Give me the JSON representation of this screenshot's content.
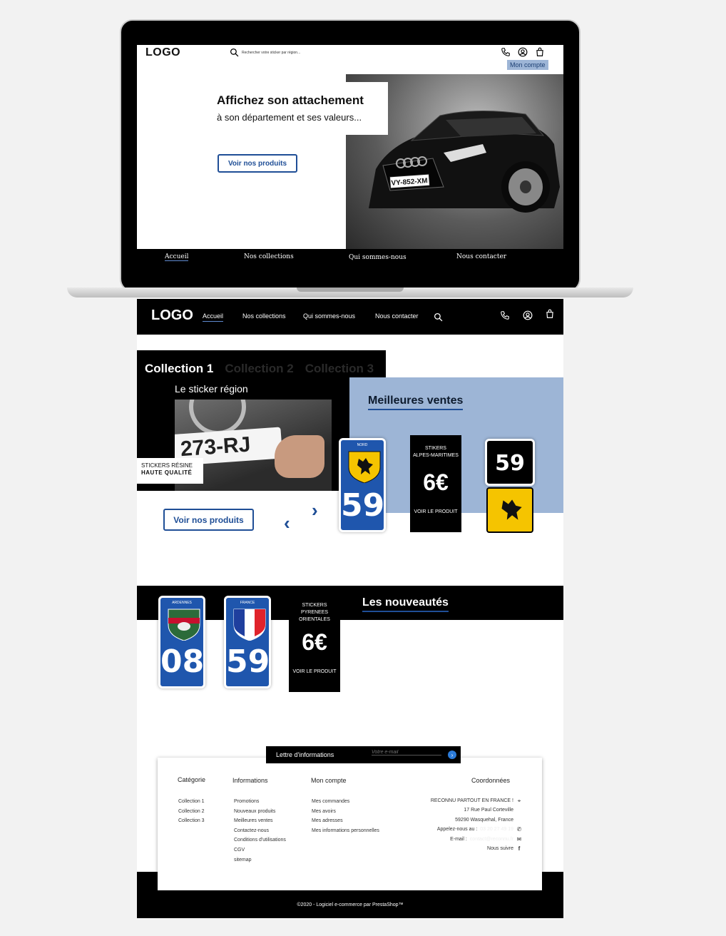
{
  "laptop": {
    "logo": "LOGO",
    "search_placeholder": "Rechercher votre sticker par région...",
    "account_label": "Mon compte",
    "hero_title": "Affichez son attachement",
    "hero_subtitle": "à son département et ses valeurs...",
    "cta": "Voir nos produits",
    "plate_text": "VY-852-XM",
    "nav": [
      "Accueil",
      "Nos collections",
      "Qui sommes-nous",
      "Nous contacter"
    ]
  },
  "header": {
    "logo": "LOGO",
    "nav": [
      "Accueil",
      "Nos collections",
      "Qui sommes-nous",
      "Nous contacter"
    ]
  },
  "collections": {
    "tabs": [
      "Collection 1",
      "Collection 2",
      "Collection 3"
    ],
    "subtitle": "Le sticker région",
    "plate_text": "273-RJ",
    "badge_line1": "STICKERS RÉSINE",
    "badge_line2": "HAUTE QUALITÉ",
    "cta": "Voir nos produits"
  },
  "best_sellers": {
    "title": "Meilleures ventes",
    "card1": {
      "region": "NORD",
      "number": "59"
    },
    "card2": {
      "line1": "STIKERS",
      "line2": "ALPES-MARITIMES",
      "price": "6€",
      "link": "VOIR LE PRODUIT"
    },
    "card3": {
      "number": "59"
    }
  },
  "new_arrivals": {
    "title": "Les nouveautés",
    "card1": {
      "region": "ARDENNES",
      "number": "08"
    },
    "card2": {
      "region": "FRANCE",
      "number": "59"
    },
    "card3": {
      "line1": "STICKERS",
      "line2": "PYRENEES",
      "line3": "ORIENTALES",
      "price": "6€",
      "link": "VOIR LE PRODUIT"
    }
  },
  "newsletter": {
    "label": "Lettre d'informations",
    "placeholder": "Votre e-mail"
  },
  "footer": {
    "headings": {
      "category": "Catégorie",
      "info": "Informations",
      "account": "Mon compte",
      "contact": "Coordonnées"
    },
    "category": [
      "Collection 1",
      "Collection 2",
      "Collection 3"
    ],
    "info": [
      "Promotions",
      "Nouveaux produits",
      "Meilleures ventes",
      "Contactez-nous",
      "Conditions d'utilisations",
      "CGV",
      "sitemap"
    ],
    "account": [
      "Mes commandes",
      "Mes avoirs",
      "Mes adresses",
      "Mes informations personnelles"
    ],
    "contact": {
      "company": "RECONNU PARTOUT EN FRANCE !",
      "street": "17 Rue Paul Corteville",
      "city": "59290 Wasquehal, France",
      "phone_label": "Appelez-nous au :",
      "phone": "03 20 27 49 19",
      "email_label": "E-mail :",
      "email": "contact@reconnu.fr",
      "follow": "Nous suivre"
    },
    "copyright": "©2020 - Logiciel e-commerce par PrestaShop™"
  }
}
